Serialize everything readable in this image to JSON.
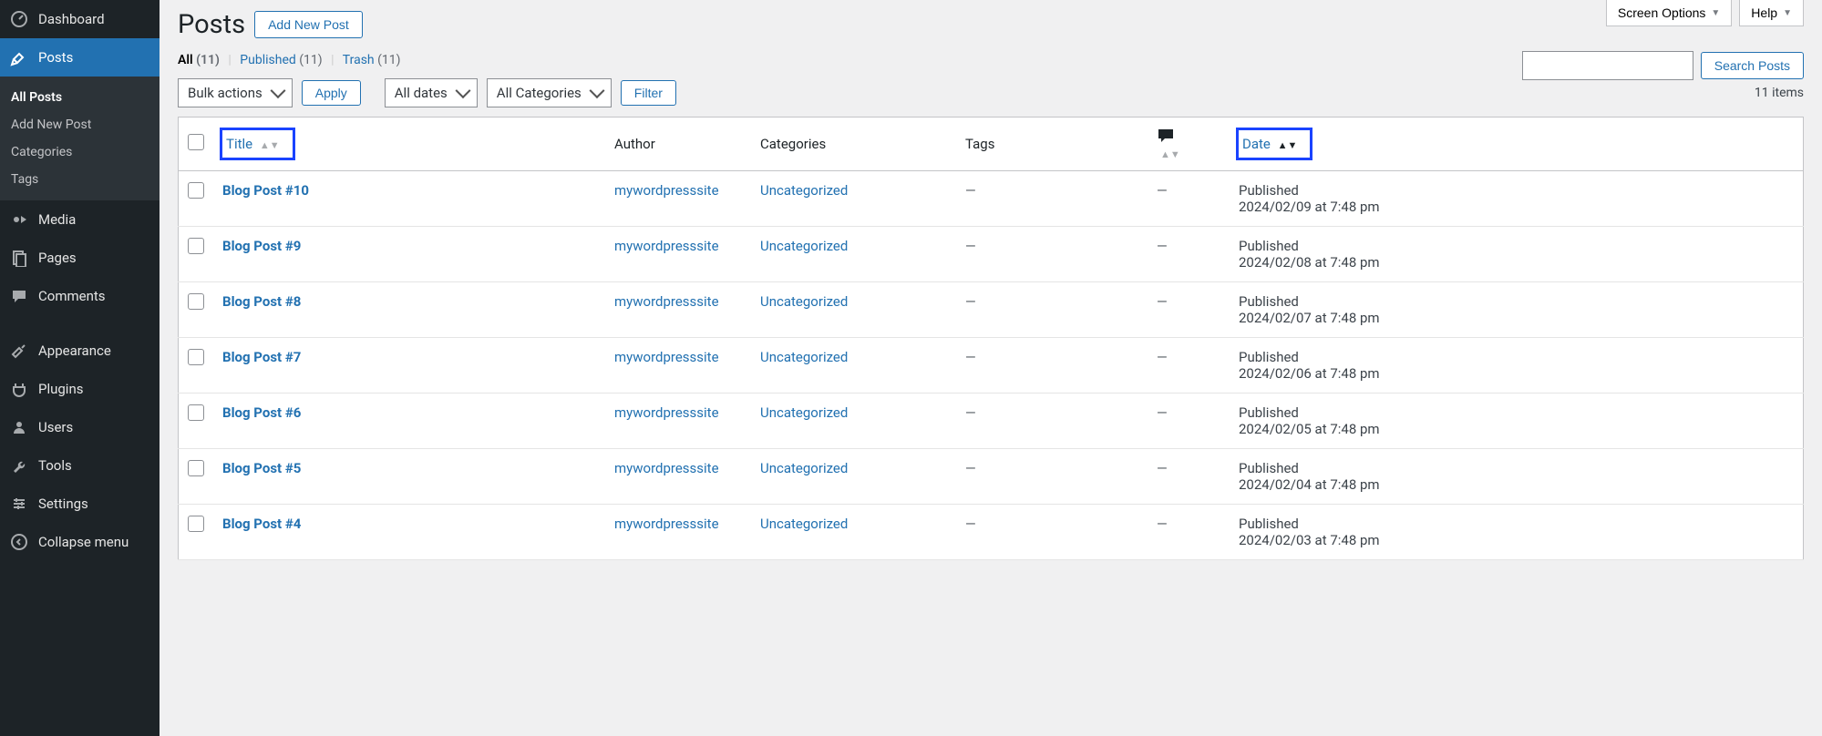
{
  "sidebar": {
    "top": [
      {
        "icon": "dashboard-icon",
        "label": "Dashboard"
      },
      {
        "icon": "pin-icon",
        "label": "Posts",
        "active": true
      },
      {
        "icon": "media-icon",
        "label": "Media"
      },
      {
        "icon": "pages-icon",
        "label": "Pages"
      },
      {
        "icon": "comments-icon",
        "label": "Comments"
      }
    ],
    "posts_submenu": [
      {
        "label": "All Posts",
        "current": true
      },
      {
        "label": "Add New Post"
      },
      {
        "label": "Categories"
      },
      {
        "label": "Tags"
      }
    ],
    "bottom": [
      {
        "icon": "appearance-icon",
        "label": "Appearance"
      },
      {
        "icon": "plugins-icon",
        "label": "Plugins"
      },
      {
        "icon": "users-icon",
        "label": "Users"
      },
      {
        "icon": "tools-icon",
        "label": "Tools"
      },
      {
        "icon": "settings-icon",
        "label": "Settings"
      },
      {
        "icon": "collapse-icon",
        "label": "Collapse menu"
      }
    ]
  },
  "screen_options_label": "Screen Options",
  "help_label": "Help",
  "page_title": "Posts",
  "add_new_label": "Add New Post",
  "subsub": {
    "all_label": "All",
    "all_count": "(11)",
    "published_label": "Published",
    "published_count": "(11)",
    "trash_label": "Trash",
    "trash_count": "(11)"
  },
  "search": {
    "button_label": "Search Posts"
  },
  "filters": {
    "bulk_actions": "Bulk actions",
    "apply": "Apply",
    "all_dates": "All dates",
    "all_categories": "All Categories",
    "filter": "Filter"
  },
  "items_count": "11 items",
  "columns": {
    "title": "Title",
    "author": "Author",
    "categories": "Categories",
    "tags": "Tags",
    "date": "Date"
  },
  "rows": [
    {
      "title": "Blog Post #10",
      "author": "mywordpresssite",
      "category": "Uncategorized",
      "tags": "—",
      "comments": "—",
      "status": "Published",
      "date": "2024/02/09 at 7:48 pm"
    },
    {
      "title": "Blog Post #9",
      "author": "mywordpresssite",
      "category": "Uncategorized",
      "tags": "—",
      "comments": "—",
      "status": "Published",
      "date": "2024/02/08 at 7:48 pm"
    },
    {
      "title": "Blog Post #8",
      "author": "mywordpresssite",
      "category": "Uncategorized",
      "tags": "—",
      "comments": "—",
      "status": "Published",
      "date": "2024/02/07 at 7:48 pm"
    },
    {
      "title": "Blog Post #7",
      "author": "mywordpresssite",
      "category": "Uncategorized",
      "tags": "—",
      "comments": "—",
      "status": "Published",
      "date": "2024/02/06 at 7:48 pm"
    },
    {
      "title": "Blog Post #6",
      "author": "mywordpresssite",
      "category": "Uncategorized",
      "tags": "—",
      "comments": "—",
      "status": "Published",
      "date": "2024/02/05 at 7:48 pm"
    },
    {
      "title": "Blog Post #5",
      "author": "mywordpresssite",
      "category": "Uncategorized",
      "tags": "—",
      "comments": "—",
      "status": "Published",
      "date": "2024/02/04 at 7:48 pm"
    },
    {
      "title": "Blog Post #4",
      "author": "mywordpresssite",
      "category": "Uncategorized",
      "tags": "—",
      "comments": "—",
      "status": "Published",
      "date": "2024/02/03 at 7:48 pm"
    }
  ]
}
